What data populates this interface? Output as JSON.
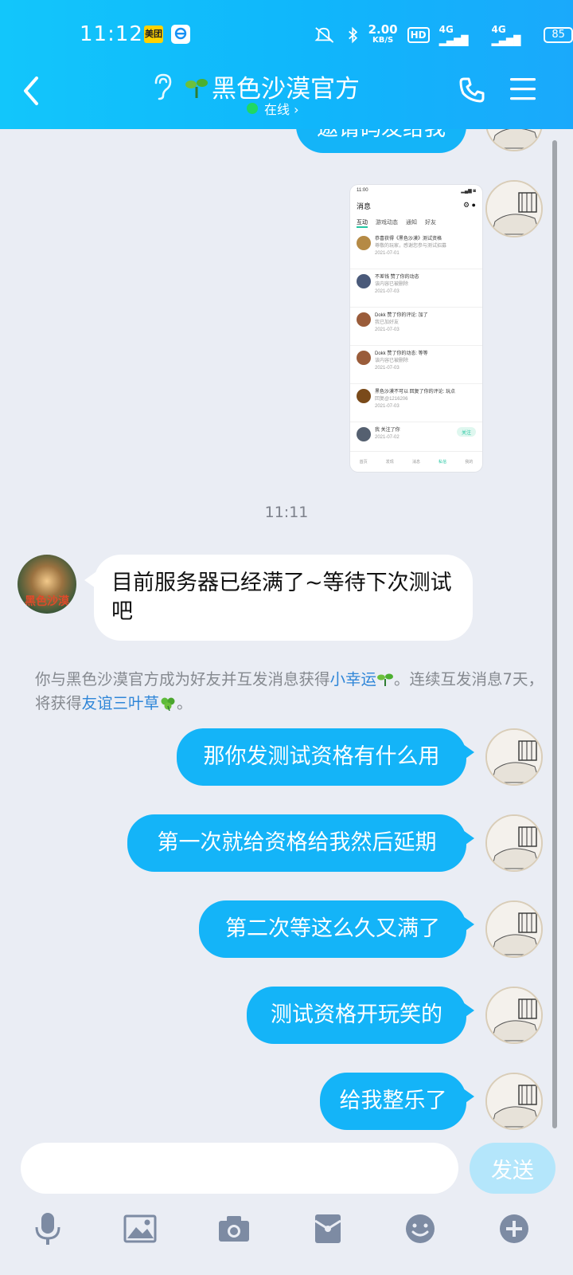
{
  "status_bar": {
    "time": "11:12",
    "app_badge": "美团",
    "speed_value": "2.00",
    "speed_unit": "KB/S",
    "hd_label": "HD",
    "net1": "4G",
    "net2": "4G",
    "battery": "85"
  },
  "header": {
    "title": "黑色沙漠官方",
    "status": "在线 ›"
  },
  "thumbnail": {
    "status_time": "11:00",
    "title": "消息",
    "tabs": [
      "互动",
      "游戏动态",
      "通知",
      "好友"
    ],
    "rows": [
      {
        "line1": "恭喜获得《黑色沙漠》测试资格",
        "line2": "尊敬的玩家，感谢您参与测试招募",
        "line3": "2021-07-01"
      },
      {
        "line1": "不差钱 赞了你的动态",
        "line2": "该内容已被删除",
        "line3": "2021-07-03"
      },
      {
        "line1": "Dokk 赞了你的评论: 加了",
        "line2": "我已加好友",
        "line3": "2021-07-03"
      },
      {
        "line1": "Dokk 赞了你的动态: 等等",
        "line2": "该内容已被删除",
        "line3": "2021-07-03"
      },
      {
        "line1": "黑色沙漠不可以 回复了你的评论: 玩点",
        "line2": "回复@1216206",
        "line3": "2021-07-03"
      },
      {
        "line1": "我 关注了你",
        "line2": "",
        "line3": "2021-07-02"
      }
    ],
    "follow_label": "关注",
    "nav": [
      "首页",
      "发现",
      "消息",
      "私信",
      "我的"
    ]
  },
  "messages": {
    "partial_top": "邀请码发给我",
    "time_separator": "11:11",
    "incoming": "目前服务器已经满了~等待下次测试吧",
    "official_avatar_text": "黑色沙漠",
    "system_note": {
      "part1": "你与黑色沙漠官方成为好友并互发消息获得",
      "link1": "小幸运",
      "part2": "。连续互发消息7天，将获得",
      "link2": "友谊三叶草",
      "part3": "。"
    },
    "outgoing": [
      "那你发测试资格有什么用",
      "第一次就给资格给我然后延期",
      "第二次等这么久又满了",
      "测试资格开玩笑的",
      "给我整乐了"
    ]
  },
  "input": {
    "placeholder": "",
    "send_label": "发送"
  },
  "colors": {
    "header": "#12c6fb",
    "bubble_out": "#14b4f8",
    "background": "#eaedf4",
    "link": "#2f86d8",
    "online": "#20d862"
  }
}
